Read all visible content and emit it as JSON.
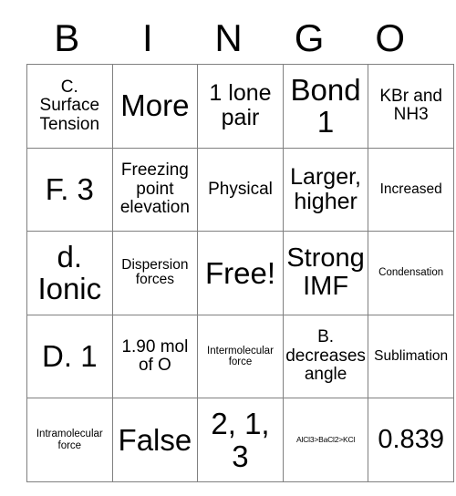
{
  "card": {
    "header": {
      "letters": [
        "B",
        "I",
        "N",
        "G",
        "O"
      ]
    },
    "rows": [
      [
        {
          "text": "C. Surface Tension",
          "size": "s-md"
        },
        {
          "text": "More",
          "size": "s-xxl"
        },
        {
          "text": "1 lone pair",
          "size": "s-lg"
        },
        {
          "text": "Bond 1",
          "size": "s-xxl"
        },
        {
          "text": "KBr and NH3",
          "size": "s-md"
        }
      ],
      [
        {
          "text": "F. 3",
          "size": "s-xxl"
        },
        {
          "text": "Freezing point elevation",
          "size": "s-md"
        },
        {
          "text": "Physical",
          "size": "s-md"
        },
        {
          "text": "Larger, higher",
          "size": "s-lg"
        },
        {
          "text": "Increased",
          "size": "s-sm"
        }
      ],
      [
        {
          "text": "d. Ionic",
          "size": "s-xxl"
        },
        {
          "text": "Dispersion forces",
          "size": "s-sm"
        },
        {
          "text": "Free!",
          "size": "s-xxl"
        },
        {
          "text": "Strong IMF",
          "size": "s-xl"
        },
        {
          "text": "Condensation",
          "size": "s-xs"
        }
      ],
      [
        {
          "text": "D. 1",
          "size": "s-xxl"
        },
        {
          "text": "1.90 mol of O",
          "size": "s-md"
        },
        {
          "text": "Intermolecular force",
          "size": "s-xs"
        },
        {
          "text": "B. decreases angle",
          "size": "s-md"
        },
        {
          "text": "Sublimation",
          "size": "s-sm"
        }
      ],
      [
        {
          "text": "Intramolecular force",
          "size": "s-xs"
        },
        {
          "text": "False",
          "size": "s-xxl"
        },
        {
          "text": "2, 1, 3",
          "size": "s-xxl"
        },
        {
          "text": "AlCl3>BaCl2>KCl",
          "size": "s-xxs"
        },
        {
          "text": "0.839",
          "size": "s-xl"
        }
      ]
    ]
  }
}
